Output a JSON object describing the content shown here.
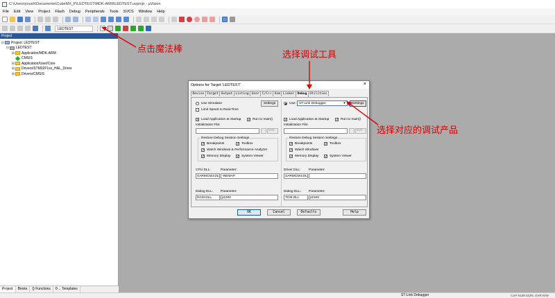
{
  "window": {
    "title": "C:\\Users\\yoush\\Documents\\CubeMX_P\\LEDTEST\\MDK-ARM\\LEDTEST.uvprojx - µVision"
  },
  "menu": [
    "File",
    "Edit",
    "View",
    "Project",
    "Flash",
    "Debug",
    "Peripherals",
    "Tools",
    "SVCS",
    "Window",
    "Help"
  ],
  "toolbar": {
    "target": "LEDTEST"
  },
  "project_panel": {
    "title": "Project",
    "root": "Project: LEDTEST",
    "target": "LEDTEST",
    "groups": [
      {
        "label": "Application/MDK-ARM",
        "icon": "folder-icon",
        "expanded": true
      },
      {
        "label": "CMSIS",
        "icon": "diamond-icon",
        "expanded": false
      },
      {
        "label": "Application/User/Core",
        "icon": "folder-icon",
        "expanded": false
      },
      {
        "label": "Drivers/STM32F1xx_HAL_Driver",
        "icon": "folder-icon",
        "expanded": true
      },
      {
        "label": "Drivers/CMSIS",
        "icon": "folder-icon",
        "expanded": true
      }
    ],
    "tabs": [
      "Project",
      "Books",
      "{} Functions",
      "0→ Templates"
    ]
  },
  "status": {
    "debugger": "ST-Link Debugger",
    "indicators": "CAP NUM SCRL OVR R/W"
  },
  "dialog": {
    "title": "Options for Target 'LEDTEST'",
    "tabs": [
      "Device",
      "Target",
      "Output",
      "Listing",
      "User",
      "C/C++",
      "Asm",
      "Linker",
      "Debug",
      "Utilities"
    ],
    "active_tab": "Debug",
    "left": {
      "use_simulator": "Use Simulator",
      "settings": "Settings",
      "limit_speed": "Limit Speed to Real-Time",
      "load_app": "Load Application at Startup",
      "run_to_main": "Run to main()",
      "init_file_label": "Initialization File:",
      "edit_button": "Edit...",
      "restore_group": "Restore Debug Session Settings",
      "breakpoints": "Breakpoints",
      "toolbox": "Toolbox",
      "watch_windows": "Watch Windows & Performance Analyzer",
      "memory_display": "Memory Display",
      "system_viewer": "System Viewer",
      "cpu_dll_label": "CPU DLL:",
      "param_label": "Parameter:",
      "cpu_dll": "SARMCM3.DLL",
      "cpu_param": "-REMAP",
      "dialog_dll_label": "Dialog DLL:",
      "dialog_dll": "DCM.DLL",
      "dialog_param": "pCM3"
    },
    "right": {
      "use": "Use:",
      "debugger": "ST-Link Debugger",
      "settings": "Settings",
      "load_app": "Load Application at Startup",
      "run_to_main": "Run to main()",
      "init_file_label": "Initialization File:",
      "edit_button": "Edit...",
      "restore_group": "Restore Debug Session Settings",
      "breakpoints": "Breakpoints",
      "toolbox": "Toolbox",
      "watch_windows": "Watch Windows",
      "memory_display": "Memory Display",
      "system_viewer": "System Viewer",
      "driver_dll_label": "Driver DLL:",
      "param_label": "Parameter:",
      "driver_dll": "SARMCM3.DLL",
      "driver_param": "",
      "dialog_dll_label": "Dialog DLL:",
      "dialog_dll": "TCM.DLL",
      "dialog_param": "pCM3"
    },
    "buttons": {
      "ok": "OK",
      "cancel": "Cancel",
      "defaults": "Defaults",
      "help": "Help"
    }
  },
  "annotations": {
    "magic_wand": "点击魔法棒",
    "select_tool": "选择调试工具",
    "select_product": "选择对应的调试产品",
    "color": "#e00000"
  }
}
